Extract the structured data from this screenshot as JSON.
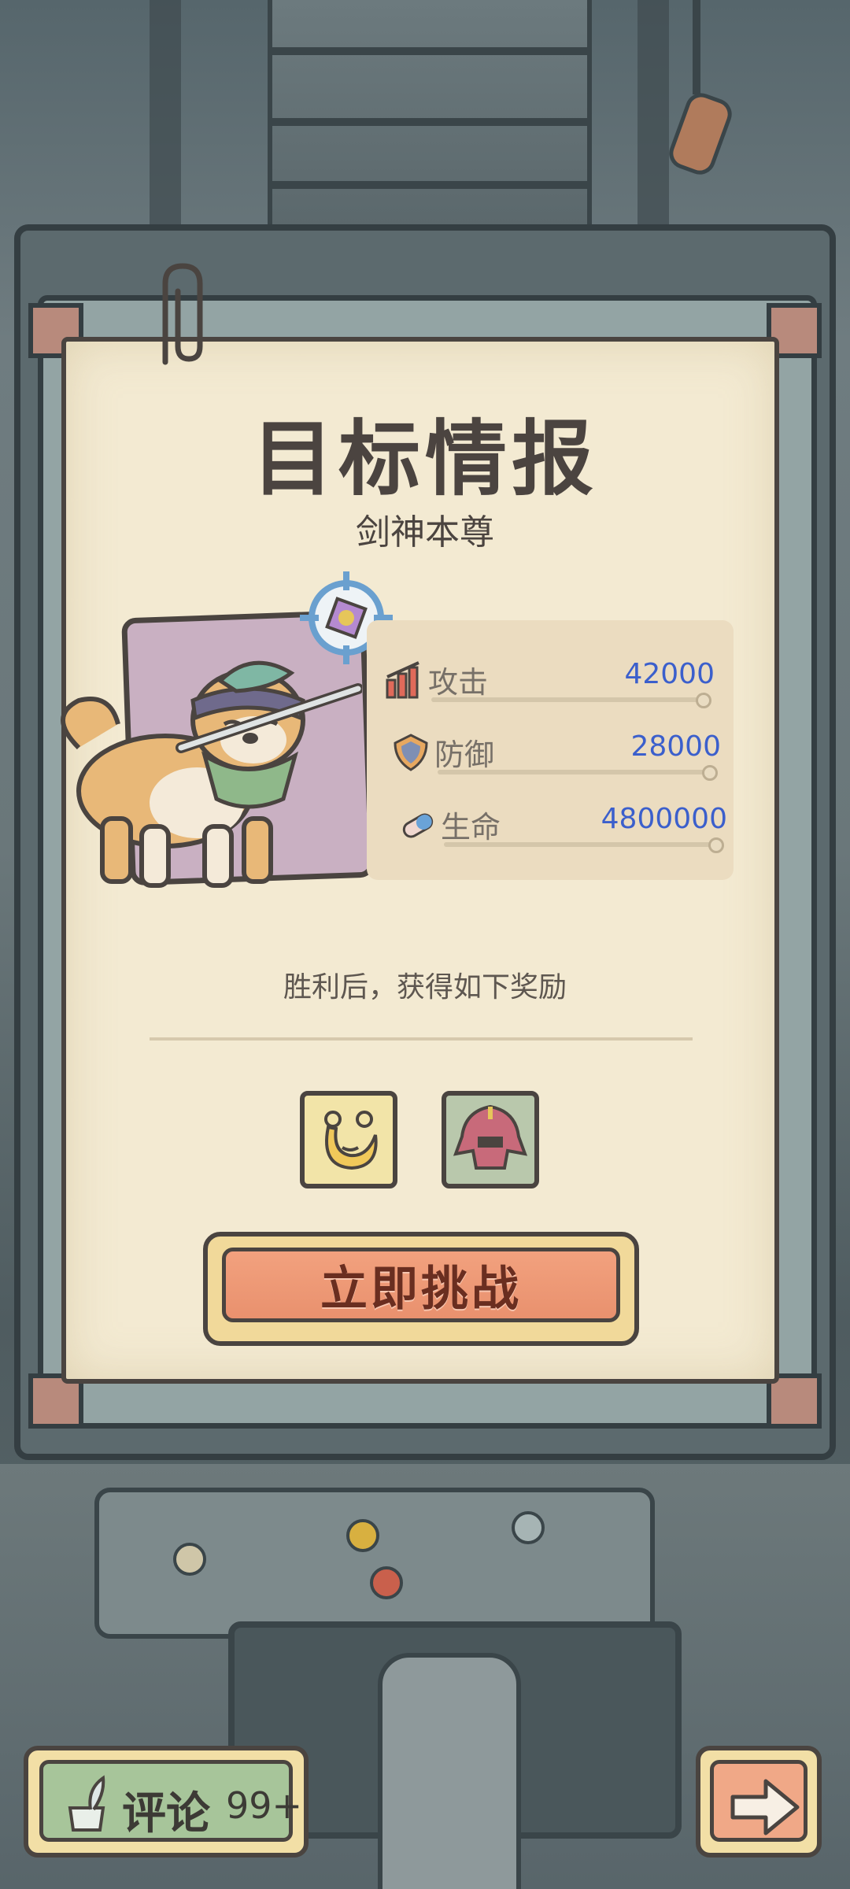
{
  "panel": {
    "title": "目标情报",
    "subtitle": "剑神本尊"
  },
  "stats": [
    {
      "label": "攻击",
      "value": "42000",
      "icon": "attack-icon"
    },
    {
      "label": "防御",
      "value": "28000",
      "icon": "defense-icon"
    },
    {
      "label": "生命",
      "value": "4800000",
      "icon": "health-icon"
    }
  ],
  "rewards": {
    "caption": "胜利后，获得如下奖励",
    "items": [
      {
        "icon": "golden-crescent-charm-icon"
      },
      {
        "icon": "samurai-helmet-icon"
      }
    ]
  },
  "actions": {
    "challenge_label": "立即挑战",
    "comment_label": "评论",
    "comment_count": "99+",
    "next_icon": "right-arrow-icon"
  },
  "colors": {
    "stat_value": "#3b5fcc",
    "challenge_button": "#e9916e",
    "comment_button": "#a7c59a",
    "card_background": "#f3ead2"
  }
}
